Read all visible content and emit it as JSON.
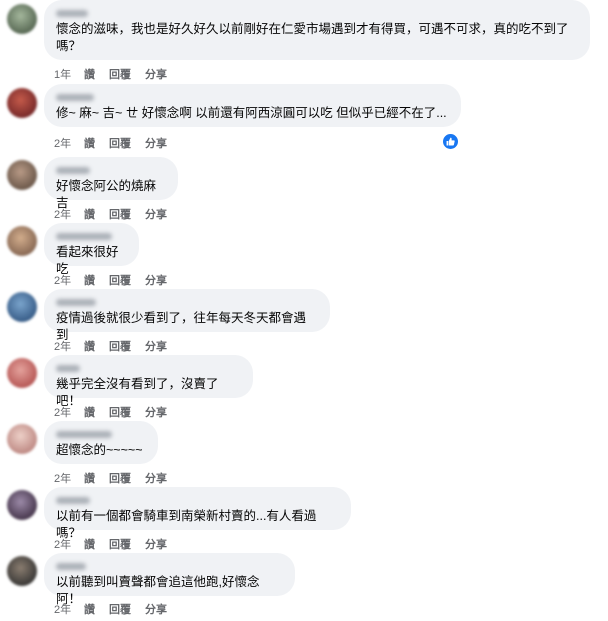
{
  "comments": [
    {
      "text": "懷念的滋味，我也是好久好久以前剛好在仁愛市場遇到才有得買，可遇不可求，真的吃不到了嗎？",
      "time": "1年",
      "like": "讚",
      "reply": "回覆",
      "share": "分享",
      "avatar_color": "#5a6b56",
      "avatar_color2": "#a4b79c"
    },
    {
      "text": "修~ 麻~ 吉~ ㄝ 好懷念啊 以前還有阿西涼圓可以吃 但似乎已經不在了...",
      "time": "2年",
      "like": "讚",
      "reply": "回覆",
      "share": "分享",
      "avatar_color": "#7a2b2b",
      "avatar_color2": "#c45a4a"
    },
    {
      "text": "好懷念阿公的燒麻吉",
      "time": "2年",
      "like": "讚",
      "reply": "回覆",
      "share": "分享",
      "avatar_color": "#6e5a4c",
      "avatar_color2": "#b89a86"
    },
    {
      "text": "看起來很好吃",
      "time": "2年",
      "like": "讚",
      "reply": "回覆",
      "share": "分享",
      "avatar_color": "#8a6a55",
      "avatar_color2": "#d2ad8c"
    },
    {
      "text": "疫情過後就很少看到了，往年每天冬天都會遇到",
      "time": "2年",
      "like": "讚",
      "reply": "回覆",
      "share": "分享",
      "avatar_color": "#3a5f8a",
      "avatar_color2": "#7aa4cc"
    },
    {
      "text": "幾乎完全沒有看到了，沒賣了吧！",
      "time": "2年",
      "like": "讚",
      "reply": "回覆",
      "share": "分享",
      "avatar_color": "#b85a58",
      "avatar_color2": "#e4a29c"
    },
    {
      "text": "超懷念的~~~~~",
      "time": "2年",
      "like": "讚",
      "reply": "回覆",
      "share": "分享",
      "avatar_color": "#c08c86",
      "avatar_color2": "#edd0c8"
    },
    {
      "text": "以前有一個都會騎車到南榮新村賣的...有人看過嗎？",
      "time": "2年",
      "like": "讚",
      "reply": "回覆",
      "share": "分享",
      "avatar_color": "#4a3a50",
      "avatar_color2": "#9c8aa8"
    },
    {
      "text": "以前聽到叫賣聲都會追這他跑,好懷念阿！",
      "time": "2年",
      "like": "讚",
      "reply": "回覆",
      "share": "分享",
      "avatar_color": "#3c3a38",
      "avatar_color2": "#8a7d70"
    }
  ],
  "reaction_icon": "like-thumb-icon",
  "colors": {
    "bubble": "#f0f2f5",
    "meta": "#65676b",
    "like_blue": "#1877f2"
  }
}
